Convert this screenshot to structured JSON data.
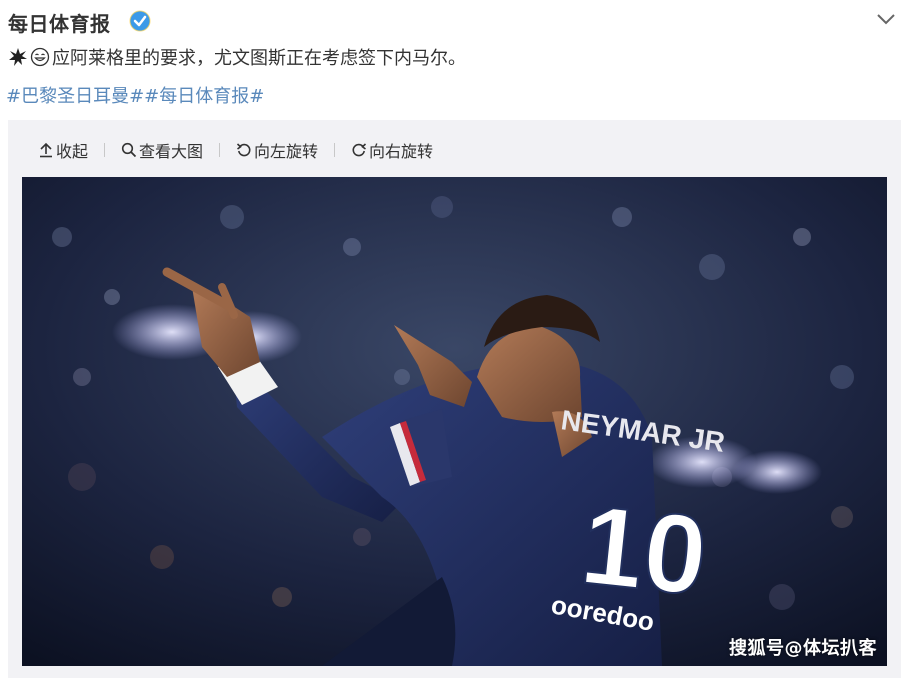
{
  "post": {
    "author": "每日体育报",
    "text": "应阿莱格里的要求，尤文图斯正在考虑签下内马尔。",
    "hashtags": [
      "#巴黎圣日耳曼#",
      "#每日体育报#"
    ]
  },
  "toolbar": {
    "collapse_label": "收起",
    "view_large_label": "查看大图",
    "rotate_left_label": "向左旋转",
    "rotate_right_label": "向右旋转"
  },
  "photo": {
    "jersey_name": "NEYMAR JR",
    "jersey_number": "10",
    "sponsor": "ooredoo",
    "watermark": "搜狐号@体坛扒客"
  },
  "colors": {
    "hashtag": "#5a89bb",
    "verified": "#3c9ae8",
    "card_bg": "#f2f2f5",
    "jersey": "#22305e"
  }
}
